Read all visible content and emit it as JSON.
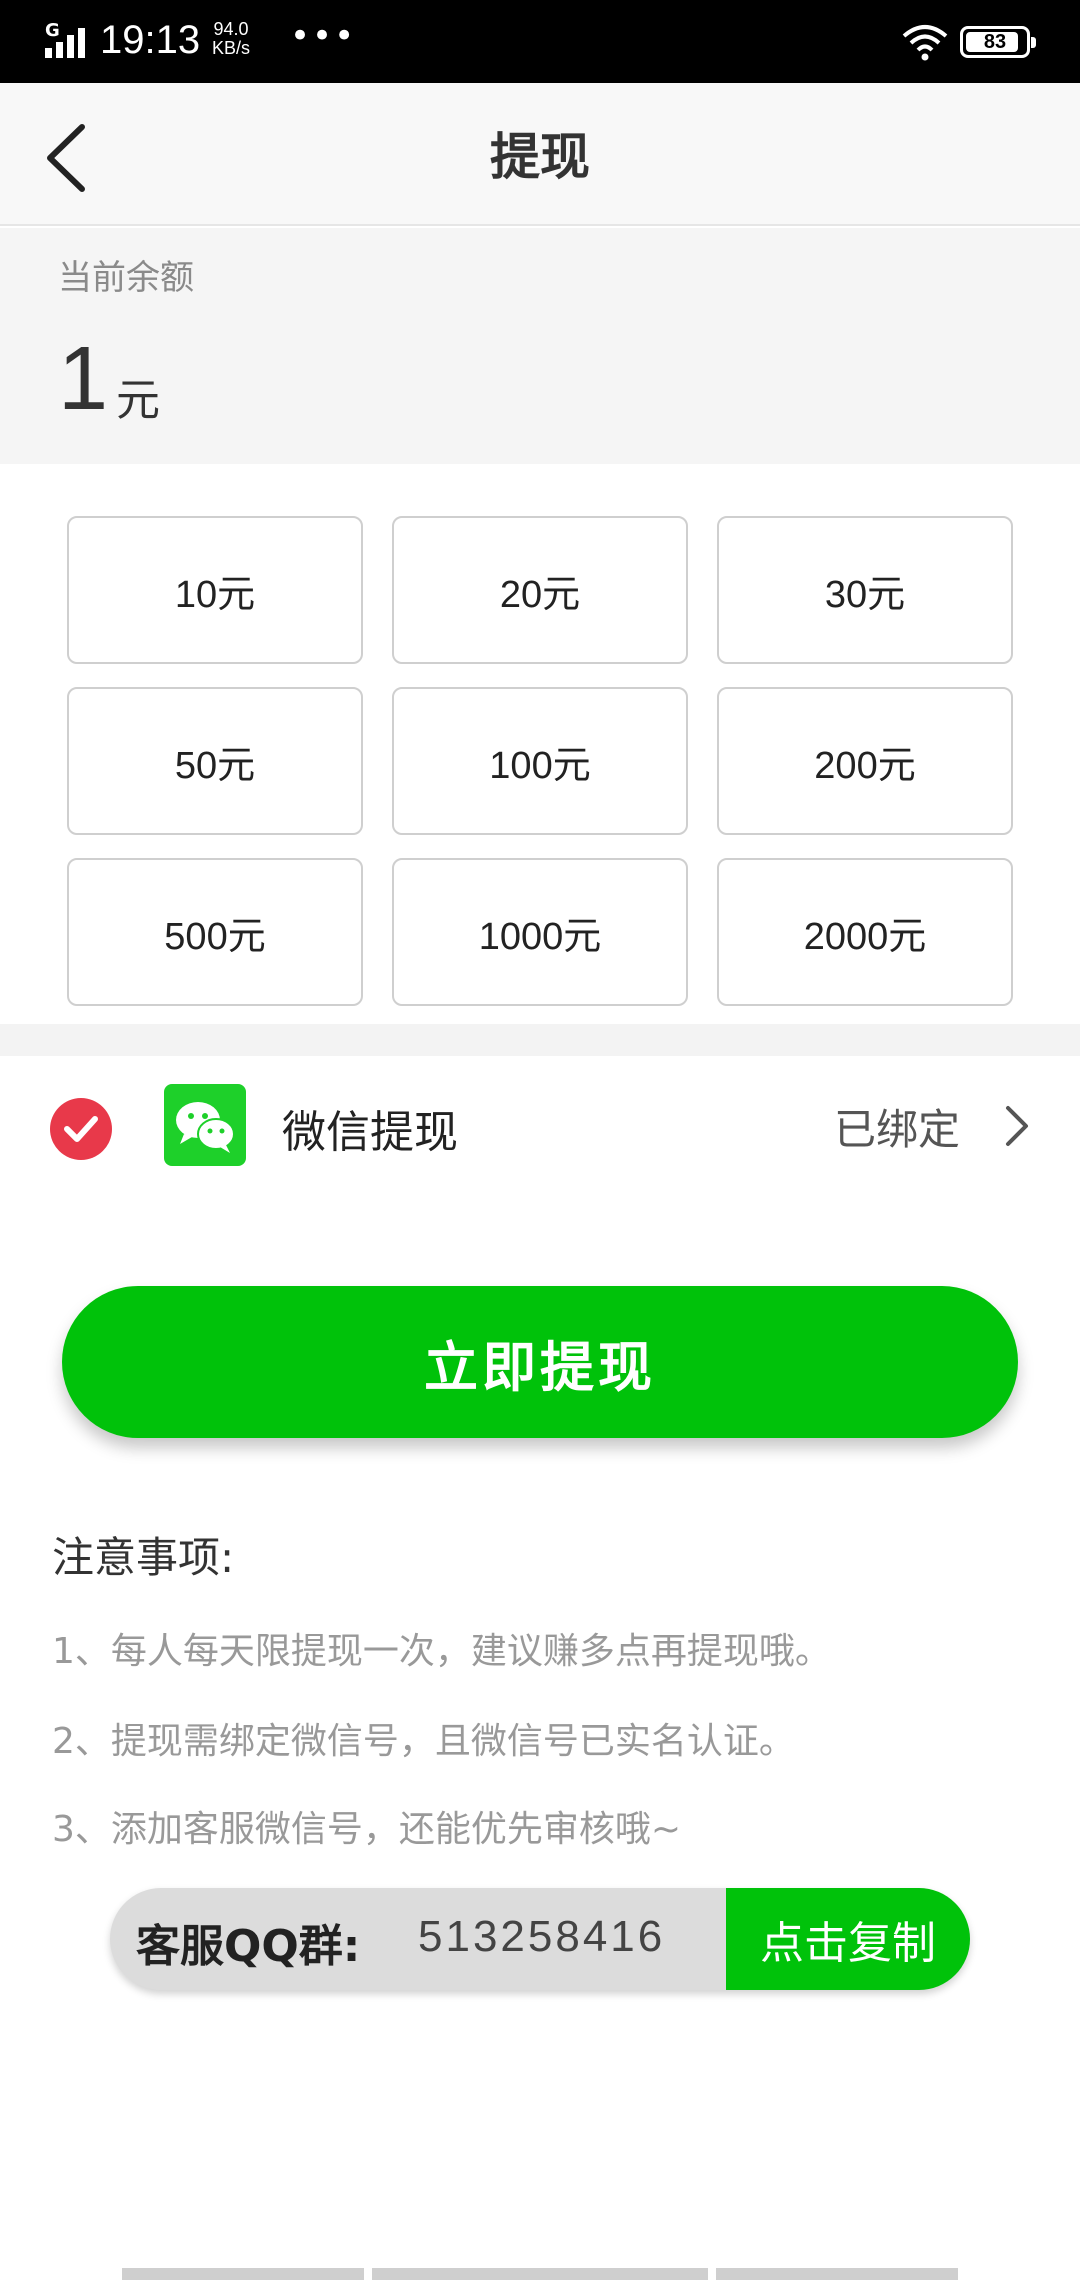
{
  "status_bar": {
    "time": "19:13",
    "speed_value": "94.0",
    "speed_unit": "KB/s",
    "battery": "83",
    "icons": [
      "signal-icon",
      "wifi-icon",
      "battery-icon",
      "more-dots-icon"
    ]
  },
  "header": {
    "title": "提现",
    "back_icon": "chevron-left-icon"
  },
  "balance": {
    "label": "当前余额",
    "amount": "1",
    "unit": "元"
  },
  "amount_options": [
    "10元",
    "20元",
    "30元",
    "50元",
    "100元",
    "200元",
    "500元",
    "1000元",
    "2000元"
  ],
  "payment": {
    "method_label": "微信提现",
    "status": "已绑定",
    "selected": true,
    "icons": [
      "check-circle-icon",
      "wechat-icon",
      "chevron-right-icon"
    ]
  },
  "withdraw_button": {
    "label": "立即提现"
  },
  "notes": {
    "title": "注意事项:",
    "items": [
      "1、每人每天限提现一次，建议赚多点再提现哦。",
      "2、提现需绑定微信号，且微信号已实名认证。",
      "3、添加客服微信号，还能优先审核哦~"
    ]
  },
  "qq_group": {
    "label": "客服QQ群:",
    "number": "513258416",
    "copy_label": "点击复制"
  },
  "colors": {
    "accent_green": "#00c20a",
    "check_red": "#e8394a",
    "wechat_green": "#1ed02a"
  }
}
